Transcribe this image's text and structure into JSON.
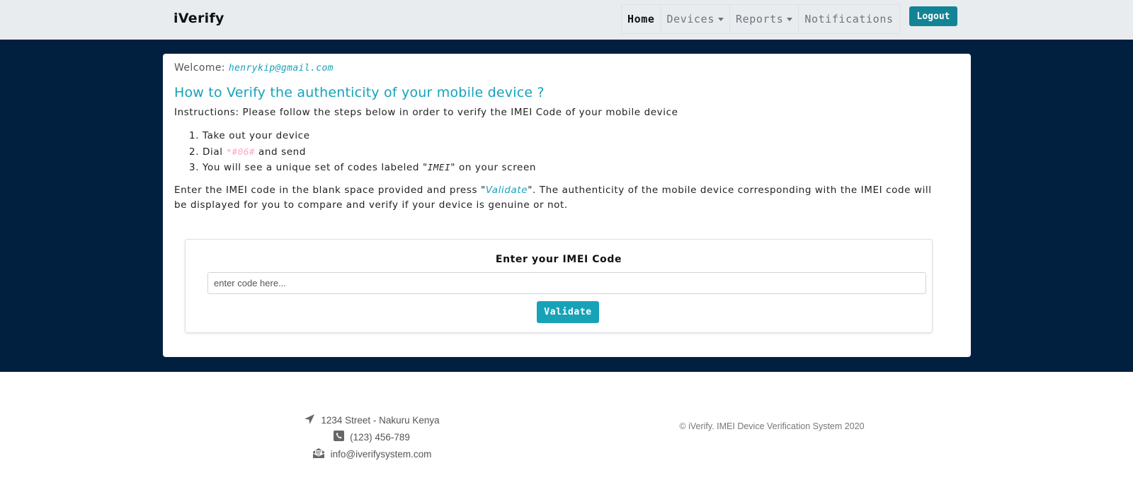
{
  "brand": "iVerify",
  "nav": {
    "items": [
      {
        "label": "Home",
        "active": true,
        "dropdown": false
      },
      {
        "label": "Devices",
        "active": false,
        "dropdown": true
      },
      {
        "label": "Reports",
        "active": false,
        "dropdown": true
      },
      {
        "label": "Notifications",
        "active": false,
        "dropdown": false
      }
    ],
    "logout_label": "Logout"
  },
  "card": {
    "welcome_label": "Welcome:",
    "welcome_email": "henrykip@gmail.com",
    "title": "How to Verify the authenticity of your mobile device ?",
    "instructions": "Instructions: Please follow the steps below in order to verify the IMEI Code of your mobile device",
    "steps": {
      "s1": "Take out your device",
      "s2_pre": "Dial",
      "s2_code": "*#06#",
      "s2_post": "and send",
      "s3_pre": "You will see a unique set of codes labeled \"",
      "s3_label": "IMEI",
      "s3_post": "\" on your screen"
    },
    "para_pre": "Enter the IMEI code in the blank space provided and press \"",
    "para_link": "Validate",
    "para_post": "\". The authenticity of the mobile device corresponding with the IMEI code will be displayed for you to compare and verify if your device is genuine or not."
  },
  "form": {
    "label": "Enter your IMEI Code",
    "placeholder": "enter code here...",
    "value": "",
    "button_label": "Validate"
  },
  "footer": {
    "address": "1234 Street - Nakuru Kenya",
    "phone": "(123) 456-789",
    "email": "info@iverifysystem.com",
    "copyright": "© iVerify. IMEI Device Verification System 2020"
  },
  "colors": {
    "accent": "#17a2b8",
    "navbar_bg": "#e9ecef",
    "band_bg": "#01203f",
    "logout_bg": "#138496",
    "code_pink": "#f4a6c6"
  },
  "icons": [
    "location-arrow-icon",
    "phone-icon",
    "envelope-open-icon"
  ]
}
